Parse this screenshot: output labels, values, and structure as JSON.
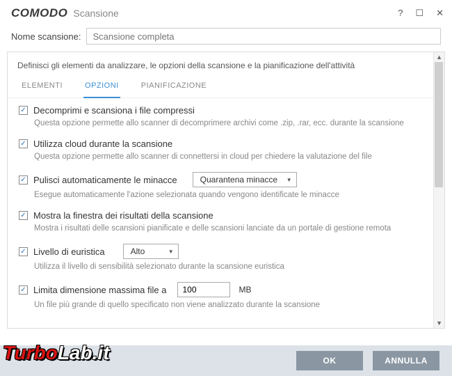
{
  "titlebar": {
    "brand": "COMODO",
    "subtitle": "Scansione"
  },
  "name_row": {
    "label": "Nome scansione:",
    "placeholder": "Scansione completa"
  },
  "panel": {
    "description": "Definisci gli elementi da analizzare, le opzioni della scansione e la pianificazione dell'attività"
  },
  "tabs": {
    "elements": "ELEMENTI",
    "options": "OPZIONI",
    "schedule": "PIANIFICAZIONE"
  },
  "options": {
    "decompress": {
      "title": "Decomprimi e scansiona i file compressi",
      "desc": "Questa opzione permette allo scanner di decomprimere archivi come .zip, .rar, ecc. durante la scansione"
    },
    "cloud": {
      "title": "Utilizza cloud durante la scansione",
      "desc": "Questa opzione permette allo scanner di connettersi in cloud per chiedere la valutazione del file"
    },
    "autoclean": {
      "title": "Pulisci automaticamente le minacce",
      "select": "Quarantena minacce",
      "desc": "Esegue automaticamente l'azione selezionata quando vengono identificate le minacce"
    },
    "results": {
      "title": "Mostra la finestra dei risultati della scansione",
      "desc": "Mostra i risultati delle scansioni pianificate e delle scansioni lanciate da un portale di gestione remota"
    },
    "heuristic": {
      "title": "Livello di euristica",
      "select": "Alto",
      "desc": "Utilizza il livello di sensibilità selezionato durante la scansione euristica"
    },
    "maxsize": {
      "title": "Limita dimensione massima file a",
      "value": "100",
      "unit": "MB",
      "desc": "Un file più grande di quello specificato non viene analizzato durante la scansione"
    }
  },
  "footer": {
    "ok": "OK",
    "cancel": "ANNULLA"
  },
  "watermark": {
    "part1": "Turbo",
    "part2": "Lab.it"
  }
}
